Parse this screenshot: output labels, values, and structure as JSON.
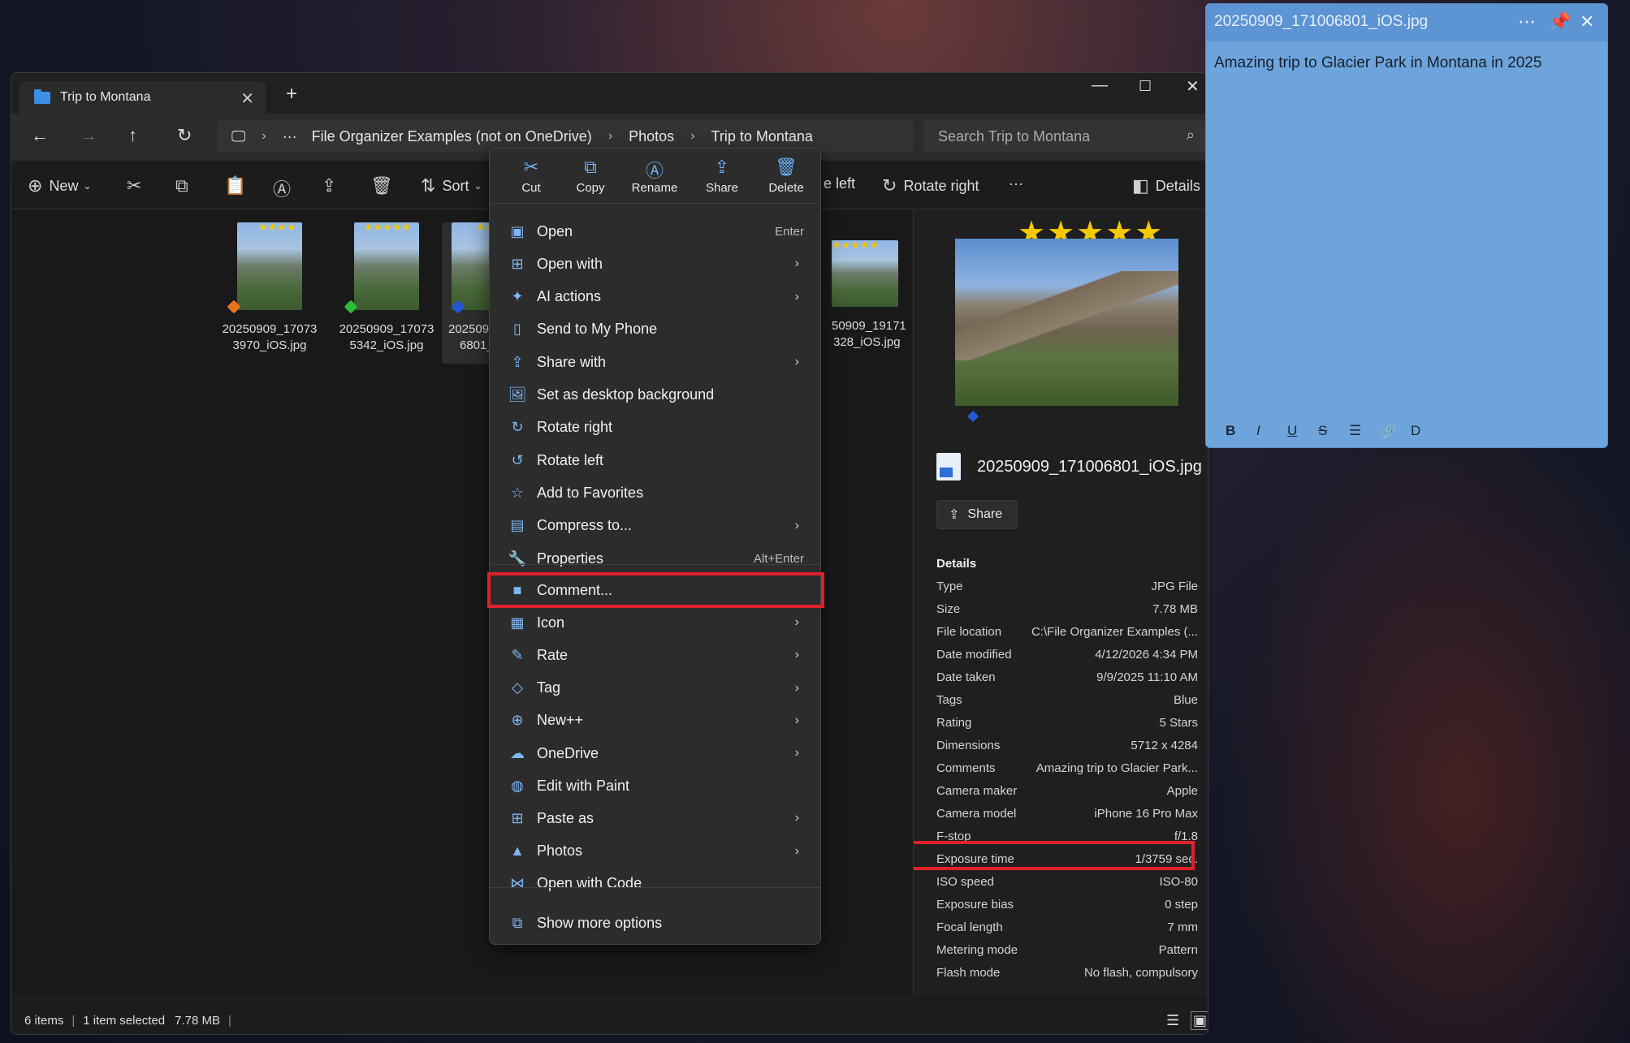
{
  "explorer": {
    "tab_title": "Trip to Montana",
    "breadcrumb": [
      "File Organizer Examples (not on OneDrive)",
      "Photos",
      "Trip to Montana"
    ],
    "breadcrumb_more": "···",
    "search_placeholder": "Search Trip to Montana",
    "toolbar": {
      "new_label": "New",
      "sort_label": "Sort",
      "rotate_left_label": "e left",
      "rotate_right_label": "Rotate right",
      "more_label": "···",
      "details_label": "Details"
    },
    "files": [
      {
        "name_line1": "20250909_17073",
        "name_line2": "3970_iOS.jpg",
        "stars": "★★★★",
        "tag_color": "#e8731a"
      },
      {
        "name_line1": "20250909_17073",
        "name_line2": "5342_iOS.jpg",
        "stars": "★★★★★",
        "tag_color": "#2dbb3a"
      },
      {
        "name_line1": "202509",
        "name_line2": "6801_",
        "stars": "★★",
        "tag_color": "#2457d6"
      },
      {
        "name_line1": "50909_19171",
        "name_line2": "328_iOS.jpg",
        "stars": "★★★★★"
      }
    ],
    "status": {
      "items": "6 items",
      "selected": "1 item selected",
      "size": "7.78 MB"
    }
  },
  "details_pane": {
    "stars": "★★★★★",
    "filename": "20250909_171006801_iOS.jpg",
    "share_label": "Share",
    "section_title": "Details",
    "properties": [
      {
        "k": "Type",
        "v": "JPG File"
      },
      {
        "k": "Size",
        "v": "7.78 MB"
      },
      {
        "k": "File location",
        "v": "C:\\File Organizer Examples (..."
      },
      {
        "k": "Date modified",
        "v": "4/12/2026 4:34 PM"
      },
      {
        "k": "Date taken",
        "v": "9/9/2025 11:10 AM"
      },
      {
        "k": "Tags",
        "v": "Blue"
      },
      {
        "k": "Rating",
        "v": "5 Stars"
      },
      {
        "k": "Dimensions",
        "v": "5712 x 4284"
      },
      {
        "k": "Comments",
        "v": "Amazing trip to Glacier Park..."
      },
      {
        "k": "Camera maker",
        "v": "Apple"
      },
      {
        "k": "Camera model",
        "v": "iPhone 16 Pro Max"
      },
      {
        "k": "F-stop",
        "v": "f/1.8"
      },
      {
        "k": "Exposure time",
        "v": "1/3759 sec."
      },
      {
        "k": "ISO speed",
        "v": "ISO-80"
      },
      {
        "k": "Exposure bias",
        "v": "0 step"
      },
      {
        "k": "Focal length",
        "v": "7 mm"
      },
      {
        "k": "Metering mode",
        "v": "Pattern"
      },
      {
        "k": "Flash mode",
        "v": "No flash, compulsory"
      }
    ]
  },
  "context_menu": {
    "quick_actions": [
      {
        "label": "Cut",
        "icon": "cut-icon"
      },
      {
        "label": "Copy",
        "icon": "copy-icon"
      },
      {
        "label": "Rename",
        "icon": "rename-icon"
      },
      {
        "label": "Share",
        "icon": "share-icon"
      },
      {
        "label": "Delete",
        "icon": "delete-icon"
      }
    ],
    "items": [
      {
        "label": "Open",
        "shortcut": "Enter"
      },
      {
        "label": "Open with",
        "submenu": true
      },
      {
        "label": "AI actions",
        "submenu": true
      },
      {
        "label": "Send to My Phone"
      },
      {
        "label": "Share with",
        "submenu": true
      },
      {
        "label": "Set as desktop background"
      },
      {
        "label": "Rotate right"
      },
      {
        "label": "Rotate left"
      },
      {
        "label": "Add to Favorites"
      },
      {
        "label": "Compress to...",
        "submenu": true
      },
      {
        "label": "Properties",
        "shortcut": "Alt+Enter"
      }
    ],
    "items2": [
      {
        "label": "Comment..."
      },
      {
        "label": "Icon",
        "submenu": true
      },
      {
        "label": "Rate",
        "submenu": true
      },
      {
        "label": "Tag",
        "submenu": true
      },
      {
        "label": "New++",
        "submenu": true
      },
      {
        "label": "OneDrive",
        "submenu": true
      },
      {
        "label": "Edit with Paint"
      },
      {
        "label": "Paste as",
        "submenu": true
      },
      {
        "label": "Photos",
        "submenu": true
      },
      {
        "label": "Open with Code"
      }
    ],
    "show_more": "Show more options"
  },
  "sticky_note": {
    "title": "20250909_171006801_iOS.jpg",
    "body": "Amazing trip to Glacier Park in Montana in 2025",
    "format_buttons": [
      "B",
      "I",
      "U",
      "S",
      "☰",
      "🔗",
      "D"
    ]
  },
  "colors": {
    "highlight": "#e0202a",
    "note_bg": "#6ea4dc",
    "accent": "#3a8ee6"
  }
}
